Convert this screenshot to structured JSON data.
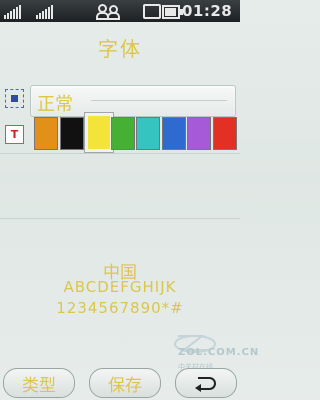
{
  "status_bar": {
    "signal_icon_1": "signal-bars-icon",
    "signal_icon_2": "signal-bars-icon",
    "contacts_icon": "people-icon",
    "sim_icon": "sim-icon",
    "battery_icon": "battery-icon",
    "time": "01:28"
  },
  "screen": {
    "title": "字体"
  },
  "font_style": {
    "icon": "font-style-icon",
    "value": "正常"
  },
  "font_color": {
    "icon": "font-color-icon",
    "swatches": [
      {
        "name": "orange",
        "color": "#e3901a"
      },
      {
        "name": "black",
        "color": "#111111"
      },
      {
        "name": "yellow",
        "color": "#f4e43a",
        "selected": true
      },
      {
        "name": "green",
        "color": "#46b035"
      },
      {
        "name": "cyan",
        "color": "#35c4c0"
      },
      {
        "name": "blue",
        "color": "#2e6ad0"
      },
      {
        "name": "purple",
        "color": "#a75ad8"
      },
      {
        "name": "red",
        "color": "#e33025"
      }
    ]
  },
  "preview": {
    "line1": "中国",
    "line2": "ABCDEFGHIJK",
    "line3": "1234567890*#"
  },
  "watermark": {
    "brand": "ZOL.COM.CN",
    "sub": "中关村在线"
  },
  "softkeys": {
    "left": "类型",
    "middle": "保存",
    "back_icon": "back-arrow-icon"
  },
  "colors": {
    "accent_text": "#dcc64a",
    "background": "#e3e9e7"
  }
}
